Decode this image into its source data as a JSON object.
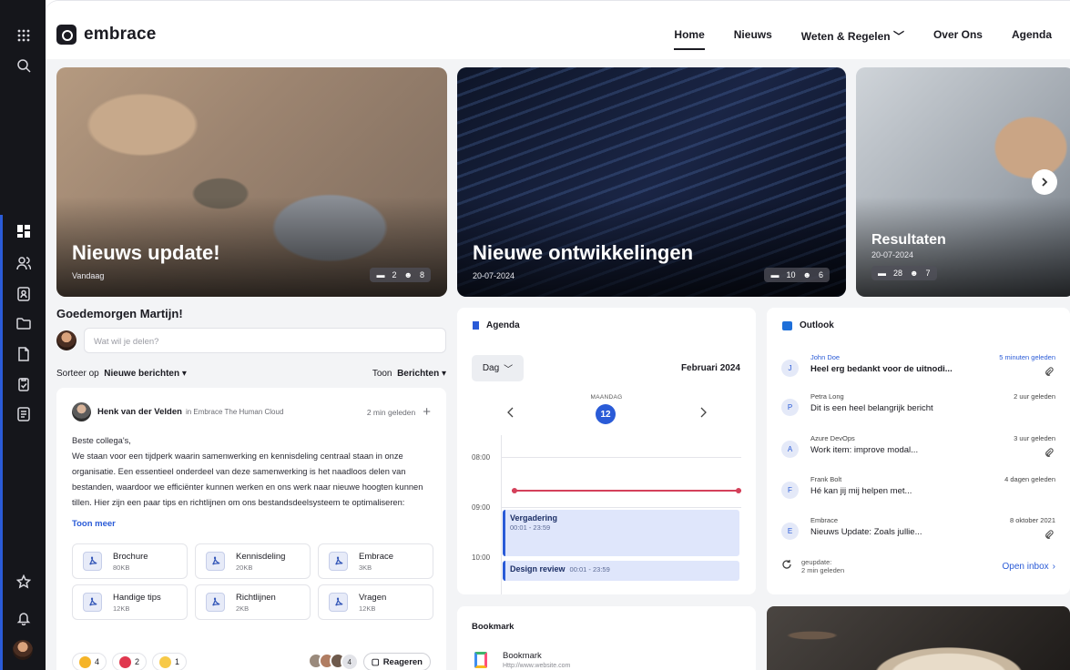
{
  "brand": {
    "name": "embrace"
  },
  "nav": {
    "items": [
      "Home",
      "Nieuws",
      "Weten & Regelen",
      "Over Ons",
      "Agenda"
    ],
    "active": "Home"
  },
  "hero": [
    {
      "title": "Nieuws update!",
      "date": "Vandaag",
      "comments": "2",
      "likes": "8"
    },
    {
      "title": "Nieuwe ontwikkelingen",
      "date": "20-07-2024",
      "comments": "10",
      "likes": "6"
    },
    {
      "title": "Resultaten",
      "date": "20-07-2024",
      "comments": "28",
      "likes": "7"
    }
  ],
  "feed": {
    "greeting": "Goedemorgen Martijn!",
    "composer_placeholder": "Wat wil je delen?",
    "sort_label": "Sorteer op",
    "sort_value": "Nieuwe berichten",
    "show_label": "Toon",
    "show_value": "Berichten"
  },
  "post": {
    "author": "Henk van der Velden",
    "location": "in Embrace The Human Cloud",
    "time": "2 min geleden",
    "greeting": "Beste collega's,",
    "body": "We staan voor een tijdperk waarin samenwerking en kennisdeling centraal staan in onze organisatie. Een essentieel onderdeel van deze samenwerking is het naadloos delen van bestanden, waardoor we efficiënter kunnen werken en ons werk naar nieuwe hoogten kunnen tillen. Hier zijn een paar tips en richtlijnen om ons bestandsdeelsysteem te optimaliseren:",
    "more": "Toon meer",
    "files": [
      {
        "name": "Brochure",
        "size": "80KB"
      },
      {
        "name": "Kennisdeling",
        "size": "20KB"
      },
      {
        "name": "Embrace",
        "size": "3KB"
      },
      {
        "name": "Handige tips",
        "size": "12KB"
      },
      {
        "name": "Richtlijnen",
        "size": "2KB"
      },
      {
        "name": "Vragen",
        "size": "12KB"
      }
    ],
    "reactions": {
      "thumbs": "4",
      "heart": "2",
      "laugh": "1"
    },
    "participants": "4",
    "reply_label": "Reageren"
  },
  "agenda": {
    "title": "Agenda",
    "view": "Dag",
    "month": "Februari 2024",
    "weekday": "MAANDAG",
    "day": "12",
    "times": [
      "08:00",
      "09:00",
      "10:00"
    ],
    "events": [
      {
        "title": "Vergadering",
        "time": "00:01 - 23:59"
      },
      {
        "title": "Design review",
        "time": "00:01 - 23:59"
      }
    ]
  },
  "outlook": {
    "title": "Outlook",
    "mails": [
      {
        "initial": "J",
        "from": "John Doe",
        "subject": "Heel erg bedankt voor de uitnodi...",
        "when": "5 minuten geleden",
        "unread": true,
        "attachment": true
      },
      {
        "initial": "P",
        "from": "Petra Long",
        "subject": "Dit is een heel belangrijk bericht",
        "when": "2 uur geleden",
        "unread": false,
        "attachment": false
      },
      {
        "initial": "A",
        "from": "Azure DevOps",
        "subject": "Work item: improve modal...",
        "when": "3 uur geleden",
        "unread": false,
        "attachment": true
      },
      {
        "initial": "F",
        "from": "Frank Bolt",
        "subject": "Hé kan jij mij helpen met...",
        "when": "4 dagen geleden",
        "unread": false,
        "attachment": false
      },
      {
        "initial": "E",
        "from": "Embrace",
        "subject": "Nieuws Update: Zoals jullie...",
        "when": "8 oktober 2021",
        "unread": false,
        "attachment": true
      }
    ],
    "updated_label": "geupdate:",
    "updated_value": "2 min geleden",
    "open_inbox": "Open inbox"
  },
  "bookmark": {
    "title": "Bookmark",
    "name": "Bookmark",
    "url": "Http://www.website.com"
  },
  "colors": {
    "accent": "#2a5bd7",
    "rail": "#15161b",
    "now_line": "#d4405a"
  }
}
